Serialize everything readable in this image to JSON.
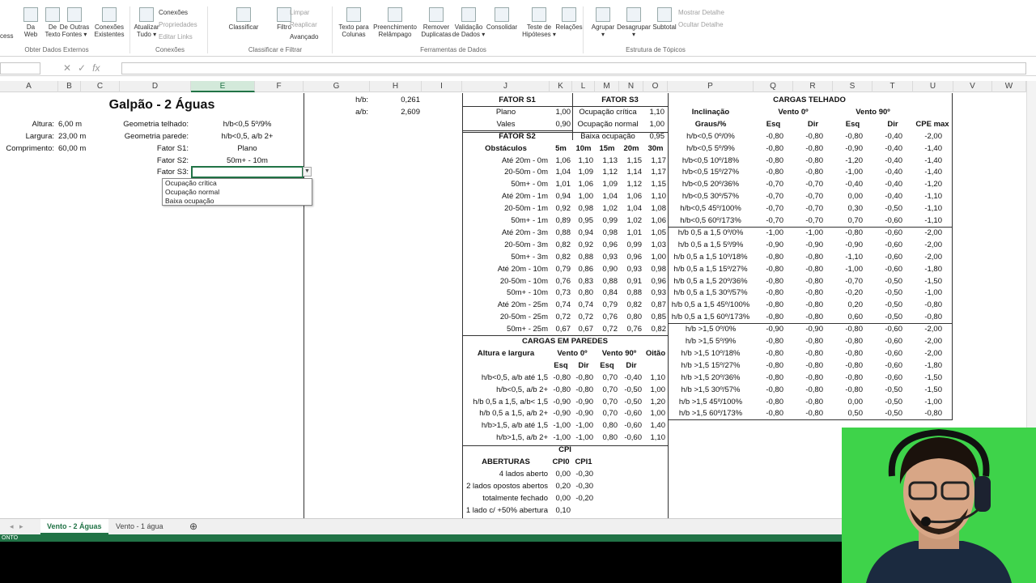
{
  "ribbon": {
    "big_buttons": [
      {
        "label": "Da\nWeb",
        "icon": "web-icon"
      },
      {
        "label": "De\nTexto",
        "icon": "text-file-icon"
      },
      {
        "label": "De Outras\nFontes ▾",
        "icon": "other-sources-icon"
      },
      {
        "label": "Conexões\nExistentes",
        "icon": "connections-icon"
      },
      {
        "label": "Atualizar\nTudo ▾",
        "icon": "refresh-icon"
      },
      {
        "label": "Classificar",
        "icon": "sort-icon"
      },
      {
        "label": "Filtro",
        "icon": "filter-icon"
      },
      {
        "label": "Texto para\nColunas",
        "icon": "text-to-columns-icon"
      },
      {
        "label": "Preenchimento\nRelâmpago",
        "icon": "flash-fill-icon"
      },
      {
        "label": "Remover\nDuplicatas",
        "icon": "remove-duplicates-icon"
      },
      {
        "label": "Validação\nde Dados ▾",
        "icon": "data-validation-icon"
      },
      {
        "label": "Consolidar",
        "icon": "consolidate-icon"
      },
      {
        "label": "Teste de\nHipóteses ▾",
        "icon": "what-if-icon"
      },
      {
        "label": "Relações",
        "icon": "relationships-icon"
      },
      {
        "label": "Agrupar\n▾",
        "icon": "group-icon"
      },
      {
        "label": "Desagrupar\n▾",
        "icon": "ungroup-icon"
      },
      {
        "label": "Subtotal",
        "icon": "subtotal-icon"
      }
    ],
    "left_fragment": "cess",
    "small": {
      "conexoes": "Conexões",
      "propriedades": "Propriedades",
      "editar_links": "Editar Links",
      "limpar": "Limpar",
      "reaplicar": "Reaplicar",
      "avancado": "Avançado",
      "mostrar": "Mostrar Detalhe",
      "ocultar": "Ocultar Detalhe"
    },
    "groups": {
      "obter": "Obter Dados Externos",
      "conexoes": "Conexões",
      "classificar": "Classificar e Filtrar",
      "ferramentas": "Ferramentas de Dados",
      "estrutura": "Estrutura de Tópicos"
    }
  },
  "formula_bar": {
    "fx": "fx"
  },
  "columns": [
    "A",
    "B",
    "C",
    "D",
    "E",
    "F",
    "G",
    "H",
    "I",
    "J",
    "K",
    "L",
    "M",
    "N",
    "O",
    "P",
    "Q",
    "R",
    "S",
    "T",
    "U",
    "V",
    "W"
  ],
  "left_block": {
    "title": "Galpão - 2 Águas",
    "altura_label": "Altura:",
    "altura_value": "6,00 m",
    "largura_label": "Largura:",
    "largura_value": "23,00 m",
    "comprimento_label": "Comprimento:",
    "comprimento_value": "60,00 m",
    "geom_telhado_label": "Geometria telhado:",
    "geom_telhado_value": "h/b<0,5 5º/9%",
    "geom_parede_label": "Geometria parede:",
    "geom_parede_value": "h/b<0,5, a/b 2+",
    "fator_s1_label": "Fator S1:",
    "fator_s1_value": "Plano",
    "fator_s2_label": "Fator S2:",
    "fator_s2_value": "50m+ - 10m",
    "fator_s3_label": "Fator S3:"
  },
  "dropdown_options": [
    "Ocupação crítica",
    "Ocupação normal",
    "Baixa ocupação"
  ],
  "ratios": {
    "hb_label": "h/b:",
    "hb_value": "0,261",
    "ab_label": "a/b:",
    "ab_value": "2,609"
  },
  "fator_s1": {
    "title": "FATOR S1",
    "rows": [
      [
        "Plano",
        "1,00"
      ],
      [
        "Vales",
        "0,90"
      ]
    ]
  },
  "fator_s3": {
    "title": "FATOR S3",
    "rows": [
      [
        "Ocupação crítica",
        "1,10"
      ],
      [
        "Ocupação normal",
        "1,00"
      ],
      [
        "Baixa ocupação",
        "0,95"
      ]
    ]
  },
  "fator_s2": {
    "title": "FATOR S2",
    "headers": [
      "Obstáculos",
      "5m",
      "10m",
      "15m",
      "20m",
      "30m"
    ],
    "rows": [
      [
        "Até 20m - 0m",
        "1,06",
        "1,10",
        "1,13",
        "1,15",
        "1,17"
      ],
      [
        "20-50m - 0m",
        "1,04",
        "1,09",
        "1,12",
        "1,14",
        "1,17"
      ],
      [
        "50m+ - 0m",
        "1,01",
        "1,06",
        "1,09",
        "1,12",
        "1,15"
      ],
      [
        "Até 20m - 1m",
        "0,94",
        "1,00",
        "1,04",
        "1,06",
        "1,10"
      ],
      [
        "20-50m - 1m",
        "0,92",
        "0,98",
        "1,02",
        "1,04",
        "1,08"
      ],
      [
        "50m+ - 1m",
        "0,89",
        "0,95",
        "0,99",
        "1,02",
        "1,06"
      ],
      [
        "Até 20m - 3m",
        "0,88",
        "0,94",
        "0,98",
        "1,01",
        "1,05"
      ],
      [
        "20-50m - 3m",
        "0,82",
        "0,92",
        "0,96",
        "0,99",
        "1,03"
      ],
      [
        "50m+ - 3m",
        "0,82",
        "0,88",
        "0,93",
        "0,96",
        "1,00"
      ],
      [
        "Até 20m - 10m",
        "0,79",
        "0,86",
        "0,90",
        "0,93",
        "0,98"
      ],
      [
        "20-50m - 10m",
        "0,76",
        "0,83",
        "0,88",
        "0,91",
        "0,96"
      ],
      [
        "50m+ - 10m",
        "0,73",
        "0,80",
        "0,84",
        "0,88",
        "0,93"
      ],
      [
        "Até 20m - 25m",
        "0,74",
        "0,74",
        "0,79",
        "0,82",
        "0,87"
      ],
      [
        "20-50m - 25m",
        "0,72",
        "0,72",
        "0,76",
        "0,80",
        "0,85"
      ],
      [
        "50m+ - 25m",
        "0,67",
        "0,67",
        "0,72",
        "0,76",
        "0,82"
      ]
    ]
  },
  "paredes": {
    "title": "CARGAS EM PAREDES",
    "h1": "Altura e largura",
    "h_v0": "Vento 0º",
    "h_v90": "Vento 90º",
    "h_oitao": "Oitão",
    "sub": [
      "Esq",
      "Dir",
      "Esq",
      "Dir"
    ],
    "rows": [
      [
        "h/b<0,5, a/b até 1,5",
        "-0,80",
        "-0,80",
        "0,70",
        "-0,40",
        "1,10"
      ],
      [
        "h/b<0,5, a/b 2+",
        "-0,80",
        "-0,80",
        "0,70",
        "-0,50",
        "1,00"
      ],
      [
        "h/b 0,5 a 1,5, a/b< 1,5",
        "-0,90",
        "-0,90",
        "0,70",
        "-0,50",
        "1,20"
      ],
      [
        "h/b 0,5 a 1,5, a/b 2+",
        "-0,90",
        "-0,90",
        "0,70",
        "-0,60",
        "1,00"
      ],
      [
        "h/b>1,5, a/b até 1,5",
        "-1,00",
        "-1,00",
        "0,80",
        "-0,60",
        "1,40"
      ],
      [
        "h/b>1,5, a/b 2+",
        "-1,00",
        "-1,00",
        "0,80",
        "-0,60",
        "1,10"
      ]
    ]
  },
  "cpi": {
    "title": "CPI",
    "h1": "ABERTURAS",
    "h2": "CPI0",
    "h3": "CPI1",
    "rows": [
      [
        "4 lados aberto",
        "0,00",
        "-0,30"
      ],
      [
        "2 lados opostos abertos",
        "0,20",
        "-0,30"
      ],
      [
        "totalmente fechado",
        "0,00",
        "-0,20"
      ],
      [
        "1 lado c/ +50% abertura",
        "0,10",
        ""
      ]
    ]
  },
  "telhado": {
    "title": "CARGAS TELHADO",
    "h_incl": "Inclinação",
    "h_graus": "Graus/%",
    "h_v0": "Vento 0º",
    "h_v90": "Vento 90º",
    "h_cpe": "CPE max",
    "sub": [
      "Esq",
      "Dir",
      "Esq",
      "Dir"
    ],
    "rows": [
      [
        "h/b<0,5 0º/0%",
        "-0,80",
        "-0,80",
        "-0,80",
        "-0,40",
        "-2,00"
      ],
      [
        "h/b<0,5 5º/9%",
        "-0,80",
        "-0,80",
        "-0,90",
        "-0,40",
        "-1,40"
      ],
      [
        "h/b<0,5 10º/18%",
        "-0,80",
        "-0,80",
        "-1,20",
        "-0,40",
        "-1,40"
      ],
      [
        "h/b<0,5 15º/27%",
        "-0,80",
        "-0,80",
        "-1,00",
        "-0,40",
        "-1,40"
      ],
      [
        "h/b<0,5 20º/36%",
        "-0,70",
        "-0,70",
        "-0,40",
        "-0,40",
        "-1,20"
      ],
      [
        "h/b<0,5 30º/57%",
        "-0,70",
        "-0,70",
        "0,00",
        "-0,40",
        "-1,10"
      ],
      [
        "h/b<0,5 45º/100%",
        "-0,70",
        "-0,70",
        "0,30",
        "-0,50",
        "-1,10"
      ],
      [
        "h/b<0,5 60º/173%",
        "-0,70",
        "-0,70",
        "0,70",
        "-0,60",
        "-1,10"
      ],
      [
        "h/b 0,5 a 1,5 0º/0%",
        "-1,00",
        "-1,00",
        "-0,80",
        "-0,60",
        "-2,00"
      ],
      [
        "h/b 0,5 a 1,5 5º/9%",
        "-0,90",
        "-0,90",
        "-0,90",
        "-0,60",
        "-2,00"
      ],
      [
        "h/b 0,5 a 1,5 10º/18%",
        "-0,80",
        "-0,80",
        "-1,10",
        "-0,60",
        "-2,00"
      ],
      [
        "h/b 0,5 a 1,5 15º/27%",
        "-0,80",
        "-0,80",
        "-1,00",
        "-0,60",
        "-1,80"
      ],
      [
        "h/b 0,5 a 1,5 20º/36%",
        "-0,80",
        "-0,80",
        "-0,70",
        "-0,50",
        "-1,50"
      ],
      [
        "h/b 0,5 a 1,5 30º/57%",
        "-0,80",
        "-0,80",
        "-0,20",
        "-0,50",
        "-1,00"
      ],
      [
        "h/b 0,5 a 1,5 45º/100%",
        "-0,80",
        "-0,80",
        "0,20",
        "-0,50",
        "-0,80"
      ],
      [
        "h/b 0,5 a 1,5 60º/173%",
        "-0,80",
        "-0,80",
        "0,60",
        "-0,50",
        "-0,80"
      ],
      [
        "h/b >1,5 0º/0%",
        "-0,90",
        "-0,90",
        "-0,80",
        "-0,60",
        "-2,00"
      ],
      [
        "h/b >1,5 5º/9%",
        "-0,80",
        "-0,80",
        "-0,80",
        "-0,60",
        "-2,00"
      ],
      [
        "h/b >1,5 10º/18%",
        "-0,80",
        "-0,80",
        "-0,80",
        "-0,60",
        "-2,00"
      ],
      [
        "h/b >1,5 15º/27%",
        "-0,80",
        "-0,80",
        "-0,80",
        "-0,60",
        "-1,80"
      ],
      [
        "h/b >1,5 20º/36%",
        "-0,80",
        "-0,80",
        "-0,80",
        "-0,60",
        "-1,50"
      ],
      [
        "h/b >1,5 30º/57%",
        "-0,80",
        "-0,80",
        "-0,80",
        "-0,50",
        "-1,50"
      ],
      [
        "h/b >1,5 45º/100%",
        "-0,80",
        "-0,80",
        "0,00",
        "-0,50",
        "-1,00"
      ],
      [
        "h/b >1,5 60º/173%",
        "-0,80",
        "-0,80",
        "0,50",
        "-0,50",
        "-0,80"
      ]
    ]
  },
  "sheets": {
    "tab1": "Vento - 2 Águas",
    "tab2": "Vento - 1 água",
    "add": "⊕"
  },
  "status": {
    "text": "ONTO"
  },
  "colors": {
    "excel_green": "#217346",
    "webcam_green": "#3ed34a"
  }
}
